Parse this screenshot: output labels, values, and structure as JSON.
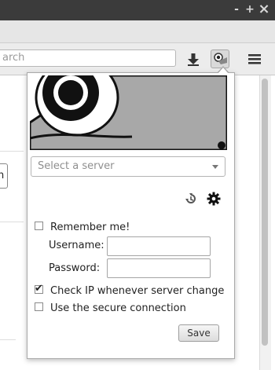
{
  "window": {
    "minimize_label": "-",
    "maximize_label": "+",
    "close_label": "×"
  },
  "navbar": {
    "search_text": "arch"
  },
  "page": {
    "box_text": "n"
  },
  "popup": {
    "server_select": {
      "placeholder": "Select a server"
    },
    "remember_me": {
      "label": "Remember me!",
      "checked": false
    },
    "username": {
      "label": "Username:",
      "value": ""
    },
    "password": {
      "label": "Password:",
      "value": ""
    },
    "check_ip": {
      "label": "Check IP whenever server change",
      "checked": true
    },
    "secure": {
      "label": "Use the secure connection",
      "checked": false
    },
    "save_label": "Save"
  },
  "icons": {
    "download": "download-arrow-icon",
    "extension": "extension-icon",
    "menu": "hamburger-menu-icon",
    "history": "history-icon",
    "settings": "gear-icon"
  }
}
